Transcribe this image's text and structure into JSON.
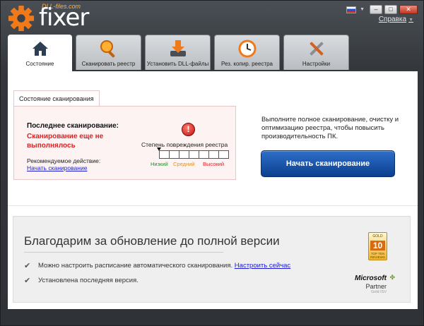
{
  "app": {
    "logo_subtitle": "DLL-files.com",
    "logo_name": "fixer",
    "help_label": "Справка"
  },
  "window_controls": {
    "minimize_glyph": "–",
    "maximize_glyph": "□",
    "close_glyph": "✕"
  },
  "tabs": [
    {
      "label": "Состояние",
      "icon": "home-icon",
      "active": true
    },
    {
      "label": "Сканировать реестр",
      "icon": "magnifier-icon",
      "active": false
    },
    {
      "label": "Установить DLL-файлы",
      "icon": "download-icon",
      "active": false
    },
    {
      "label": "Рез. копир. реестра",
      "icon": "clock-backup-icon",
      "active": false
    },
    {
      "label": "Настройки",
      "icon": "tools-icon",
      "active": false
    }
  ],
  "scan_status": {
    "tab_label": "Состояние сканирования",
    "last_scan_label": "Последнее сканирование:",
    "last_scan_value": "Сканирование еще не выполнялось",
    "recommended_label": "Рекомендуемое действие:",
    "recommended_link": "Начать сканирование",
    "warning_glyph": "!",
    "damage_label": "Степень повреждения реестра",
    "levels": {
      "low": "Низкий",
      "mid": "Средний",
      "high": "Высокий"
    }
  },
  "action": {
    "description": "Выполните полное сканирование, очистку и оптимизацию реестра, чтобы повысить производительность ПК.",
    "button_label": "Начать сканирование"
  },
  "promo": {
    "title": "Благодарим за обновление до полной версии",
    "item1_text": "Можно настроить расписание автоматического сканирования.",
    "item1_link": "Настроить сейчас",
    "item2_text": "Установлена последняя версия.",
    "check_glyph": "✔"
  },
  "award": {
    "line1": "GOLD",
    "line2": "10",
    "line3": "TOP TEN REVIEWS"
  },
  "microsoft": {
    "name": "Microsoft",
    "partner": "Partner",
    "sub": "Gold ISV"
  },
  "colors": {
    "accent_orange": "#f07a1a",
    "primary_button": "#1a55b0",
    "error_red": "#e02020",
    "link_blue": "#1a1ad0"
  }
}
